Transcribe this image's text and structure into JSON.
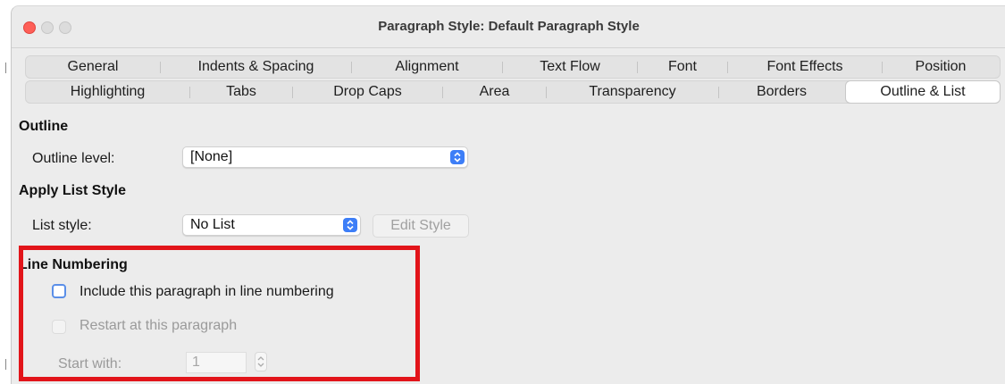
{
  "window": {
    "title": "Paragraph Style: Default Paragraph Style"
  },
  "tabs": {
    "row1": [
      "General",
      "Indents & Spacing",
      "Alignment",
      "Text Flow",
      "Font",
      "Font Effects",
      "Position"
    ],
    "row2": [
      "Highlighting",
      "Tabs",
      "Drop Caps",
      "Area",
      "Transparency",
      "Borders",
      "Outline & List"
    ],
    "selected": "Outline & List"
  },
  "outline": {
    "section_title": "Outline",
    "level_label": "Outline level:",
    "level_value": "[None]"
  },
  "list_style": {
    "section_title": "Apply List Style",
    "label": "List style:",
    "value": "No List",
    "edit_button": "Edit Style"
  },
  "line_numbering": {
    "section_title": "Line Numbering",
    "include_label": "Include this paragraph in line numbering",
    "include_checked": false,
    "restart_label": "Restart at this paragraph",
    "restart_checked": false,
    "start_with_label": "Start with:",
    "start_with_value": "1"
  },
  "colors": {
    "highlight_border": "#e2141a",
    "accent": "#3d7ef7",
    "close_button": "#fe5f57"
  }
}
